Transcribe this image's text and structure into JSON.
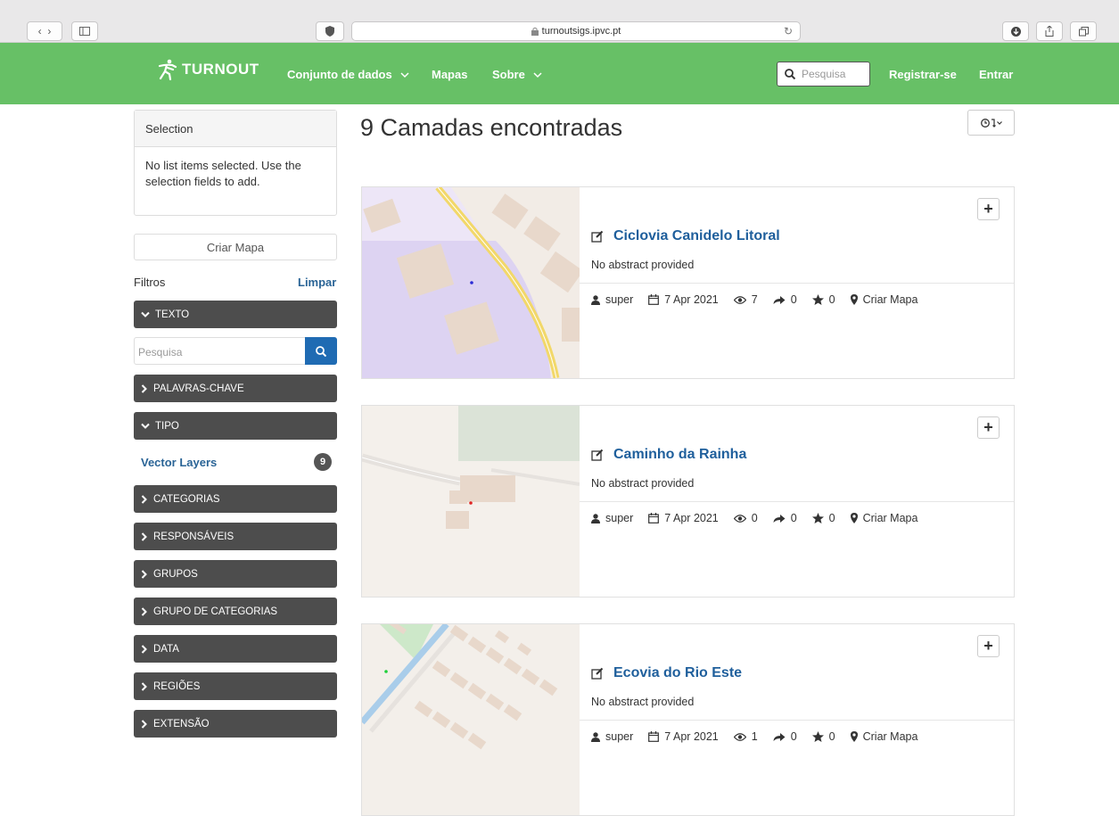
{
  "browser": {
    "url": "turnoutsigs.ipvc.pt"
  },
  "navbar": {
    "brand": "TURNOUT",
    "links": {
      "datasets": "Conjunto de dados",
      "maps": "Mapas",
      "about": "Sobre"
    },
    "search_placeholder": "Pesquisa",
    "register": "Registrar-se",
    "login": "Entrar"
  },
  "sidebar": {
    "selection_title": "Selection",
    "selection_empty": "No list items selected. Use the selection fields to add.",
    "create_map": "Criar Mapa",
    "filters_label": "Filtros",
    "clear_label": "Limpar",
    "facets": {
      "texto": "TEXTO",
      "palavras": "PALAVRAS-CHAVE",
      "tipo": "TIPO",
      "categorias": "CATEGORIAS",
      "responsaveis": "RESPONSÁVEIS",
      "grupos": "GRUPOS",
      "grupo_categorias": "GRUPO DE CATEGORIAS",
      "data": "DATA",
      "regioes": "REGIÕES",
      "extensao": "EXTENSÃO"
    },
    "text_search_placeholder": "Pesquisa",
    "vector_layers": {
      "label": "Vector Layers",
      "count": "9"
    }
  },
  "main": {
    "result_title": "9 Camadas encontradas",
    "cards": [
      {
        "title": "Ciclovia Canidelo Litoral",
        "abstract": "No abstract provided",
        "owner": "super",
        "date": "7 Apr 2021",
        "views": "7",
        "shares": "0",
        "rating": "0",
        "create_map": "Criar Mapa"
      },
      {
        "title": "Caminho da Rainha",
        "abstract": "No abstract provided",
        "owner": "super",
        "date": "7 Apr 2021",
        "views": "0",
        "shares": "0",
        "rating": "0",
        "create_map": "Criar Mapa"
      },
      {
        "title": "Ecovia do Rio Este",
        "abstract": "No abstract provided",
        "owner": "super",
        "date": "7 Apr 2021",
        "views": "1",
        "shares": "0",
        "rating": "0",
        "create_map": "Criar Mapa"
      }
    ]
  },
  "colors": {
    "navbar": "#67c066",
    "facet": "#4d4d4d",
    "link": "#1f5f9c",
    "search_button": "#1f6bb3"
  }
}
